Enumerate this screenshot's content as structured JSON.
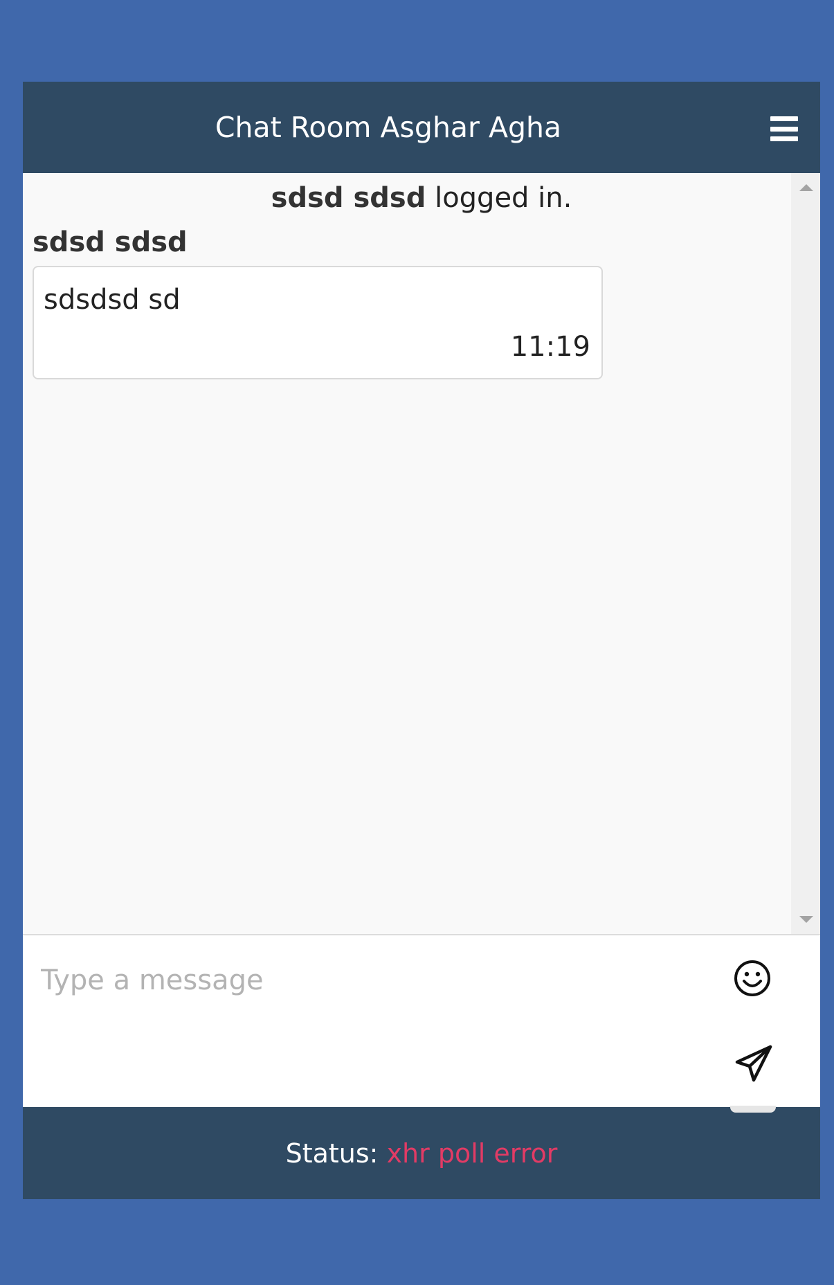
{
  "header": {
    "title": "Chat Room Asghar Agha",
    "menu_icon": "hamburger-menu-icon"
  },
  "messages": {
    "system": {
      "user": "sdsd sdsd",
      "text": "logged in."
    },
    "items": [
      {
        "sender": "sdsd sdsd",
        "text": "sdsdsd sd",
        "time": "11:19"
      }
    ]
  },
  "composer": {
    "placeholder": "Type a message",
    "value": "",
    "emoji_icon": "smiley-icon",
    "send_icon": "paper-plane-icon"
  },
  "footer": {
    "status_label": "Status:",
    "status_value": "xhr poll error",
    "status_color": "#e23b65"
  },
  "colors": {
    "background": "#4068ab",
    "header": "#2f4a63",
    "footer": "#2f4a63"
  }
}
